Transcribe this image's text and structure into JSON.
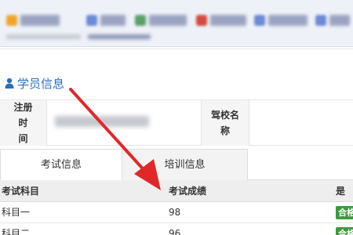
{
  "section": {
    "title": "学员信息"
  },
  "info": {
    "reg_time_label": "注册时间",
    "reg_time_label_lines": [
      "注册时",
      "间"
    ],
    "school_label_lines": [
      "驾校名",
      "称"
    ]
  },
  "tabs": [
    {
      "label": "考试信息",
      "active": true
    },
    {
      "label": "培训信息",
      "active": false
    }
  ],
  "table": {
    "columns": [
      "考试科目",
      "考试成绩",
      "是否"
    ],
    "rows": [
      {
        "subject": "科目一",
        "score": "98",
        "pass": "合格"
      },
      {
        "subject": "科目二",
        "score": "96",
        "pass": "合格"
      }
    ]
  },
  "colors": {
    "accent_blue": "#2a6fc0",
    "arrow_red": "#e0282a",
    "pass_green": "#3c9a3c"
  },
  "icons": {
    "section": "person-icon"
  }
}
